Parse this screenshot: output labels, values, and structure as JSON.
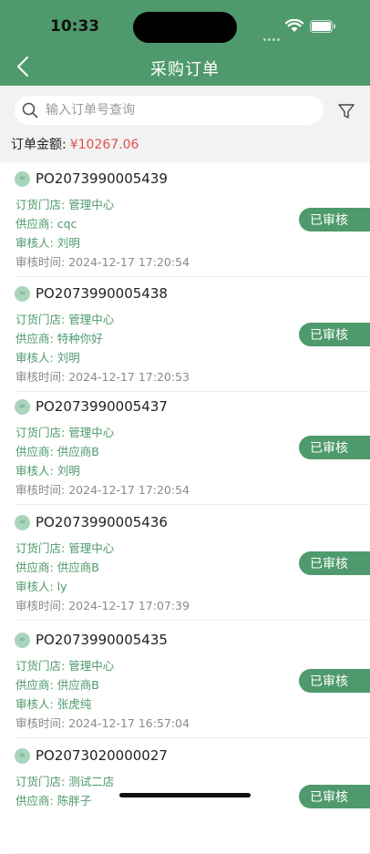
{
  "status_bar": {
    "time": "10:33"
  },
  "header": {
    "title": "采购订单"
  },
  "search": {
    "placeholder": "输入订单号查询"
  },
  "summary": {
    "label": "订单金额:",
    "amount": "¥10267.06"
  },
  "labels": {
    "store": "订货门店:",
    "supplier": "供应商:",
    "reviewer": "审核人:",
    "review_time": "审核时间:"
  },
  "orders": [
    {
      "no": "PO2073990005439",
      "store": "管理中心",
      "supplier": "cqc",
      "reviewer": "刘明",
      "time": "2024-12-17 17:20:54",
      "status": "已审核"
    },
    {
      "no": "PO2073990005438",
      "store": "管理中心",
      "supplier": "特种你好",
      "reviewer": "刘明",
      "time": "2024-12-17 17:20:53",
      "status": "已审核"
    },
    {
      "no": "PO2073990005437",
      "store": "管理中心",
      "supplier": "供应商B",
      "reviewer": "刘明",
      "time": "2024-12-17 17:20:54",
      "status": "已审核"
    },
    {
      "no": "PO2073990005436",
      "store": "管理中心",
      "supplier": "供应商B",
      "reviewer": "ly",
      "time": "2024-12-17 17:07:39",
      "status": "已审核"
    },
    {
      "no": "PO2073990005435",
      "store": "管理中心",
      "supplier": "供应商B",
      "reviewer": "张虎纯",
      "time": "2024-12-17 16:57:04",
      "status": "已审核"
    },
    {
      "no": "PO2073020000027",
      "store": "测试二店",
      "supplier": "陈胖子",
      "reviewer": "",
      "time": "",
      "status": "已审核"
    }
  ],
  "colors": {
    "brand": "#4f9a6c",
    "amount": "#e0504f",
    "background": "#f2f2f2"
  }
}
